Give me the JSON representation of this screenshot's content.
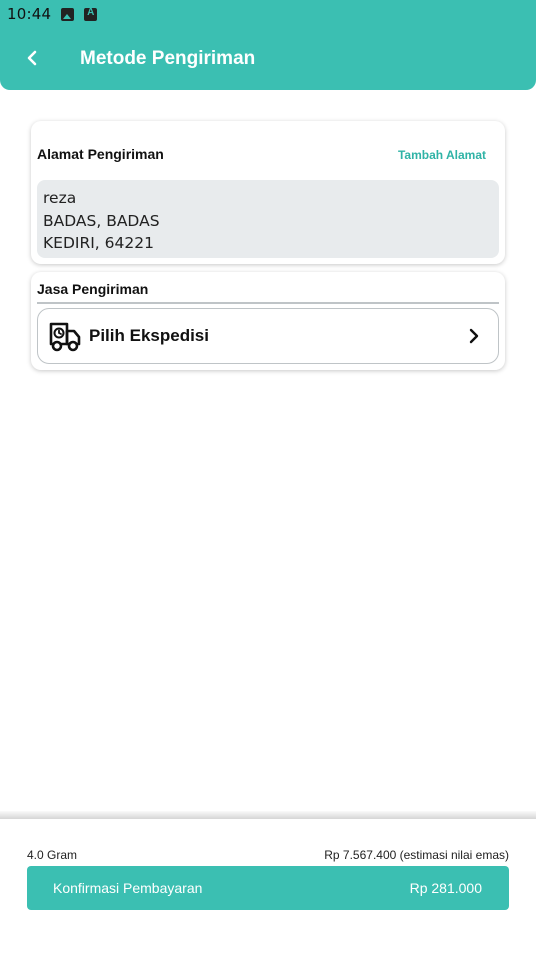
{
  "status_bar": {
    "time": "10:44",
    "icons": [
      "image-icon",
      "font-icon"
    ]
  },
  "header": {
    "title": "Metode Pengiriman",
    "back_icon": "chevron-left-icon",
    "background_color": "#3bbfb2"
  },
  "address_card": {
    "title": "Alamat Pengiriman",
    "add_link": "Tambah Alamat",
    "lines": [
      "reza",
      "BADAS, BADAS",
      "KEDIRI, 64221"
    ]
  },
  "shipping_card": {
    "title": "Jasa Pengiriman",
    "select_label": "Pilih Ekspedisi",
    "select_icon": "truck-icon",
    "chevron_icon": "chevron-right-icon"
  },
  "footer": {
    "weight": "4.0 Gram",
    "estimate": "Rp 7.567.400 (estimasi nilai emas)",
    "confirm_label": "Konfirmasi Pembayaran",
    "confirm_price": "Rp 281.000",
    "accent_color": "#3bbfb2"
  }
}
